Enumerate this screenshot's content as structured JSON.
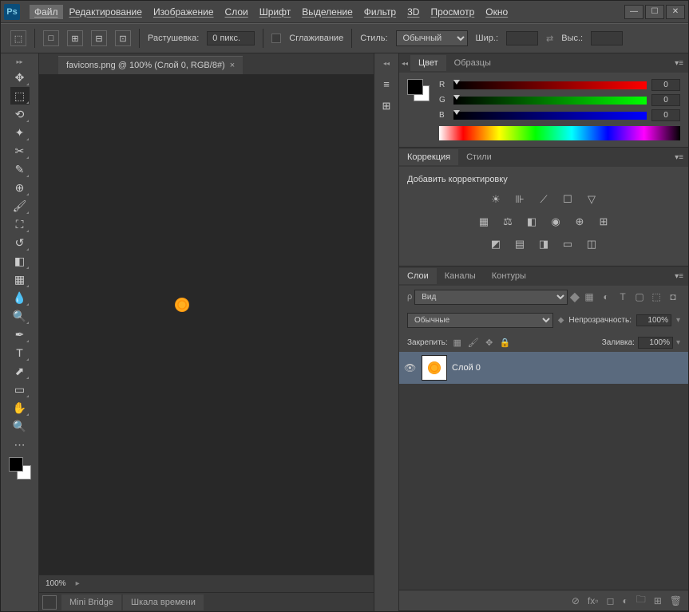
{
  "titlebar": {
    "logo": "Ps"
  },
  "menubar": {
    "items": [
      "Файл",
      "Редактирование",
      "Изображение",
      "Слои",
      "Шрифт",
      "Выделение",
      "Фильтр",
      "3D",
      "Просмотр",
      "Окно"
    ]
  },
  "optionsbar": {
    "feather_label": "Растушевка:",
    "feather_value": "0 пикс.",
    "antialias_label": "Сглаживание",
    "style_label": "Стиль:",
    "style_value": "Обычный",
    "width_label": "Шир.:",
    "height_label": "Выс.:"
  },
  "document": {
    "tab_title": "favicons.png @ 100% (Слой 0, RGB/8#)",
    "zoom": "100%"
  },
  "bottom_panels": {
    "mini_bridge": "Mini Bridge",
    "timeline": "Шкала времени"
  },
  "color_panel": {
    "tab_color": "Цвет",
    "tab_swatches": "Образцы",
    "channels": {
      "r": {
        "label": "R",
        "value": "0"
      },
      "g": {
        "label": "G",
        "value": "0"
      },
      "b": {
        "label": "B",
        "value": "0"
      }
    }
  },
  "adjustments_panel": {
    "tab_adjustments": "Коррекция",
    "tab_styles": "Стили",
    "header": "Добавить корректировку"
  },
  "layers_panel": {
    "tab_layers": "Слои",
    "tab_channels": "Каналы",
    "tab_paths": "Контуры",
    "filter_label": "Вид",
    "blend_mode": "Обычные",
    "opacity_label": "Непрозрачность:",
    "opacity_value": "100%",
    "lock_label": "Закрепить:",
    "fill_label": "Заливка:",
    "fill_value": "100%",
    "layers": [
      {
        "name": "Слой 0",
        "visible": true
      }
    ]
  }
}
